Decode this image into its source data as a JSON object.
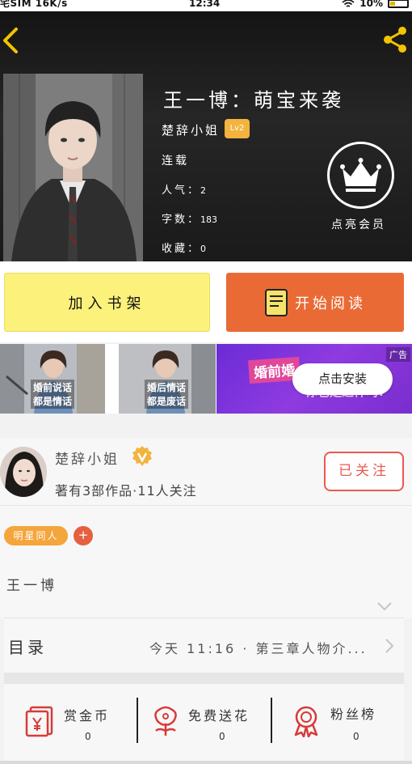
{
  "status_bar": {
    "left": "宅SIM 16K/s",
    "time": "12:34",
    "battery": "10%"
  },
  "book": {
    "title": "王一博：萌宝来袭",
    "author": "楚辞小姐",
    "level": "Lv2",
    "status": "连载",
    "popularity_label": "人气：",
    "popularity": "2",
    "words_label": "字数：",
    "words": "183",
    "favorites_label": "收藏：",
    "favorites": "0"
  },
  "vip": {
    "label": "点亮会员"
  },
  "actions": {
    "add_shelf": "加入书架",
    "start_read": "开始阅读"
  },
  "ad": {
    "caption1_line1": "婚前说话",
    "caption1_line2": "都是情话",
    "caption2_line1": "婚后情话",
    "caption2_line2": "都是废话",
    "headline": "婚前婚",
    "headline2": "你也是这样吗?",
    "tag": "广告",
    "install": "点击安装"
  },
  "author_card": {
    "name": "楚辞小姐",
    "meta": "著有3部作品·11人关注",
    "follow": "已关注"
  },
  "tags": [
    {
      "label": "明星同人"
    }
  ],
  "tag_add": "+",
  "description": "王一博",
  "toc": {
    "label": "目录",
    "latest": "今天 11:16 · 第三章人物介..."
  },
  "bottom": {
    "reward": {
      "label": "赏金币",
      "count": "0"
    },
    "flowers": {
      "label": "免费送花",
      "count": "0"
    },
    "fans": {
      "label": "粉丝榜",
      "count": "0"
    }
  },
  "colors": {
    "accent_orange": "#ea6a35",
    "shelf_yellow": "#fcf17a",
    "follow_red": "#e85a4f",
    "level_badge": "#f3b33e",
    "tag_orange": "#f4a53c"
  }
}
